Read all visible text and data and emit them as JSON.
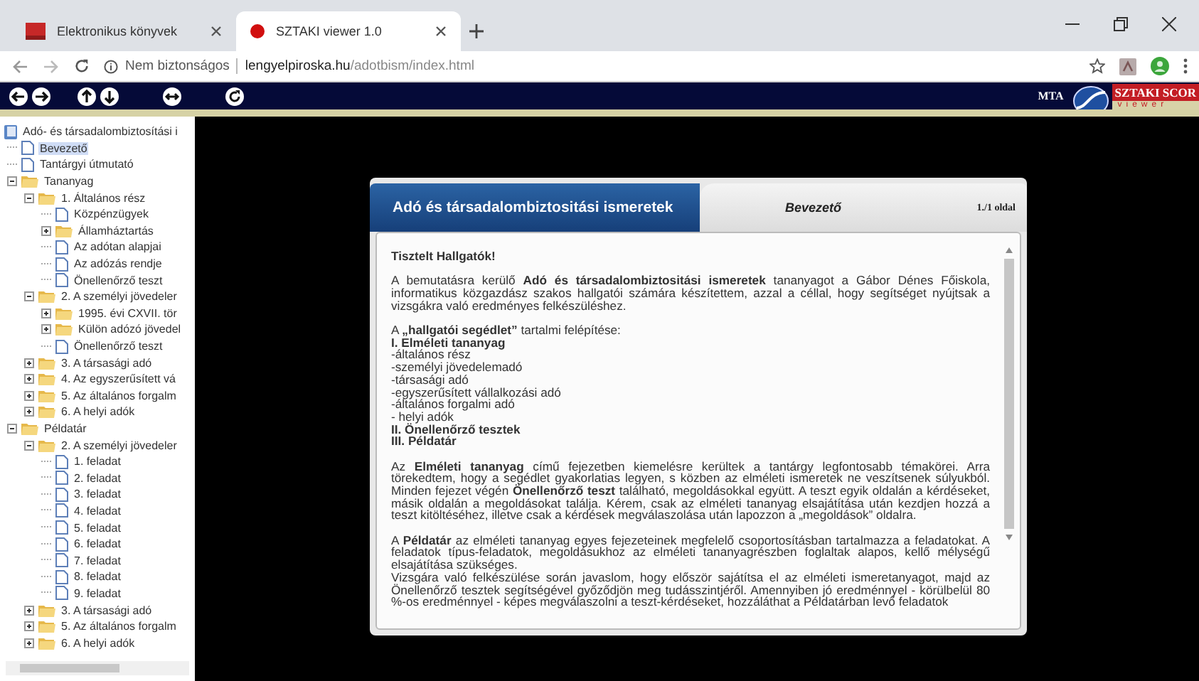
{
  "browser": {
    "tabs": [
      {
        "title": "Elektronikus könyvek",
        "selected": false
      },
      {
        "title": "SZTAKI viewer 1.0",
        "selected": true
      }
    ],
    "security": "Nem biztonságos",
    "url_host": "lengyelpiroska.hu",
    "url_path": "/adotbism/index.html"
  },
  "viewer": {
    "brand": "MTA",
    "logo_title": "SZTAKI SCOR",
    "logo_sub": "viewer"
  },
  "tree": {
    "root": "Adó- és társadalombiztosítási i",
    "items": [
      {
        "label": "Bevezető",
        "kind": "page",
        "selected": true
      },
      {
        "label": "Tantárgyi útmutató",
        "kind": "page",
        "selected": false
      },
      {
        "label": "Tananyag",
        "kind": "folder",
        "expanded": true,
        "selected": false,
        "children": [
          {
            "label": "1. Általános rész",
            "kind": "folder",
            "expanded": true,
            "selected": false,
            "children": [
              {
                "label": "Közpénzügyek",
                "kind": "page",
                "selected": false
              },
              {
                "label": "Államháztartás",
                "kind": "folder",
                "expanded": false,
                "selected": false
              },
              {
                "label": "Az adótan alapjai",
                "kind": "page",
                "selected": false
              },
              {
                "label": "Az adózás rendje",
                "kind": "page",
                "selected": false
              },
              {
                "label": "Önellenőrző teszt",
                "kind": "page",
                "selected": false
              }
            ]
          },
          {
            "label": "2. A személyi jövedeler",
            "kind": "folder",
            "expanded": true,
            "selected": false,
            "children": [
              {
                "label": "1995. évi CXVII. tör",
                "kind": "folder",
                "expanded": false,
                "selected": false
              },
              {
                "label": "Külön adózó jövedel",
                "kind": "folder",
                "expanded": false,
                "selected": false
              },
              {
                "label": "Önellenőrző teszt",
                "kind": "page",
                "selected": false
              }
            ]
          },
          {
            "label": "3. A társasági adó",
            "kind": "folder",
            "expanded": false,
            "selected": false
          },
          {
            "label": "4. Az egyszerűsített vá",
            "kind": "folder",
            "expanded": false,
            "selected": false
          },
          {
            "label": "5. Az általános forgalm",
            "kind": "folder",
            "expanded": false,
            "selected": false
          },
          {
            "label": "6. A helyi adók",
            "kind": "folder",
            "expanded": false,
            "selected": false
          }
        ]
      },
      {
        "label": "Példatár",
        "kind": "folder",
        "expanded": true,
        "selected": false,
        "children": [
          {
            "label": "2. A személyi jövedeler",
            "kind": "folder",
            "expanded": true,
            "selected": false,
            "children": [
              {
                "label": "1. feladat",
                "kind": "page",
                "selected": false
              },
              {
                "label": "2. feladat",
                "kind": "page",
                "selected": false
              },
              {
                "label": "3. feladat",
                "kind": "page",
                "selected": false
              },
              {
                "label": "4. feladat",
                "kind": "page",
                "selected": false
              },
              {
                "label": "5. feladat",
                "kind": "page",
                "selected": false
              },
              {
                "label": "6. feladat",
                "kind": "page",
                "selected": false
              },
              {
                "label": "7. feladat",
                "kind": "page",
                "selected": false
              },
              {
                "label": "8. feladat",
                "kind": "page",
                "selected": false
              },
              {
                "label": "9. feladat",
                "kind": "page",
                "selected": false
              }
            ]
          },
          {
            "label": "3. A társasági adó",
            "kind": "folder",
            "expanded": false,
            "selected": false
          },
          {
            "label": "5. Az általános forgalm",
            "kind": "folder",
            "expanded": false,
            "selected": false
          },
          {
            "label": "6. A helyi adók",
            "kind": "folder",
            "expanded": false,
            "selected": false
          }
        ]
      }
    ]
  },
  "document": {
    "title": "Adó és társadalombiztositási ismeretek",
    "section": "Bevezető",
    "page": "1./1 oldal",
    "blocks": [
      {
        "kind": "heading",
        "text": "Tisztelt Hallgatók!"
      },
      {
        "kind": "paragraph",
        "texts": [
          "A bemutatásra kerülő **Adó és társadalombiztositási ismeretek** tananyagot a Gábor Dénes Főiskola, informatikus közgazdász szakos hallgatói számára készítettem, azzal a céllal, hogy segítséget nyújtsak a vizsgákra való eredményes felkészüléshez."
        ]
      },
      {
        "kind": "list",
        "lines": [
          {
            "text": "A **„hallgatói segédlet”** tartalmi felépítése:",
            "bold": false
          },
          {
            "text": "I. Elméleti tananyag",
            "bold": true
          },
          {
            "text": "-általános rész",
            "bold": false
          },
          {
            "text": "-személyi jövedelemadó",
            "bold": false
          },
          {
            "text": "-társasági adó",
            "bold": false
          },
          {
            "text": "-egyszerűsített vállalkozási adó",
            "bold": false
          },
          {
            "text": "-általános forgalmi adó",
            "bold": false
          },
          {
            "text": "- helyi adók",
            "bold": false
          },
          {
            "text": "II. Önellenőrző tesztek",
            "bold": true
          },
          {
            "text": "III. Példatár",
            "bold": true
          }
        ]
      },
      {
        "kind": "paragraph",
        "texts": [
          "Az **Elméleti tananyag** című fejezetben kiemelésre kerültek a tantárgy legfontosabb témakörei. Arra törekedtem, hogy a segédlet gyakorlatias legyen, s közben az elméleti ismeretek ne veszítsenek súlyukból. Minden fejezet végén **Önellenőrző teszt** található, megoldásokkal együtt. A teszt egyik oldalán a kérdéseket, másik oldalán a megoldásokat találja. Kérem, csak az elméleti tananyag elsajátítása után kezdjen hozzá a teszt kitöltéséhez, illetve csak a kérdések megválaszolása után lapozzon a „megoldások” oldalra."
        ]
      },
      {
        "kind": "paragraph",
        "texts": [
          "A **Példatár** az elméleti tananyag egyes fejezeteinek megfelelő csoportosításban tartalmazza a feladatokat. A feladatok típus-feladatok, megoldásukhoz az elméleti tananyagrészben foglaltak alapos, kellő mélységű elsajátítása szükséges.",
          "Vizsgára való felkészülése során javaslom, hogy először sajátítsa el az elméleti ismeretanyagot, majd az Önellenőrző tesztek segítségével győződjön meg tudásszintjéről. Amennyiben jó eredménnyel - körülbelül 80 %-os eredménnyel - képes megválaszolni a teszt-kérdéseket, hozzáláthat a Példatárban levő feladatok"
        ]
      }
    ]
  }
}
